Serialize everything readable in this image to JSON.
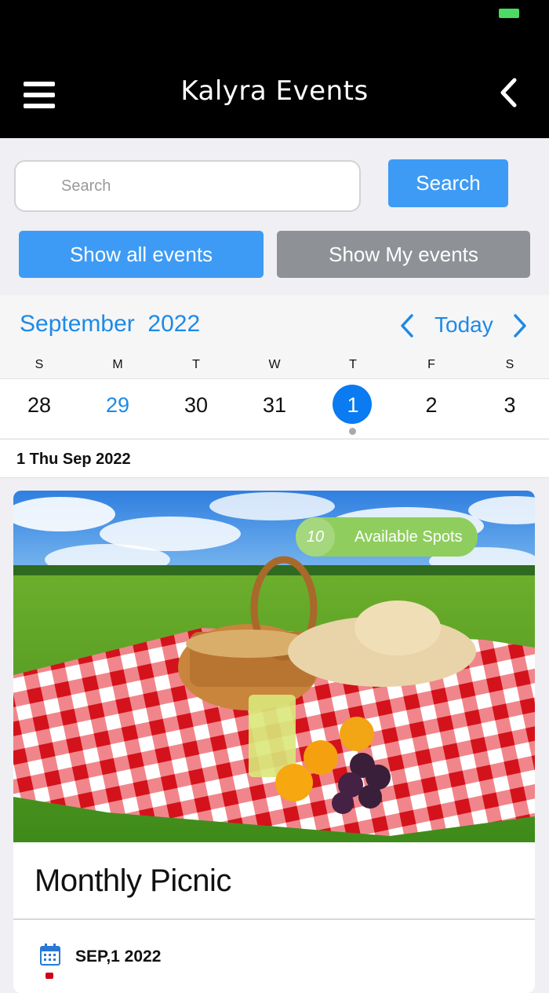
{
  "header": {
    "title": "Kalyra Events"
  },
  "search": {
    "placeholder": "Search",
    "value": "",
    "button_label": "Search"
  },
  "filters": {
    "all_label": "Show all events",
    "mine_label": "Show My events"
  },
  "calendar": {
    "month": "September",
    "year": "2022",
    "today_label": "Today",
    "weekdays": [
      "S",
      "M",
      "T",
      "W",
      "T",
      "F",
      "S"
    ],
    "days": [
      "28",
      "29",
      "30",
      "31",
      "1",
      "2",
      "3"
    ],
    "today_index": 1,
    "selected_index": 4
  },
  "selected_date_label": "1 Thu Sep 2022",
  "event": {
    "spots_count": "10",
    "spots_label": "Available Spots",
    "title": "Monthly Picnic",
    "date": "SEP,1 2022"
  },
  "colors": {
    "accent": "#3d9bf5",
    "calendar_blue": "#1d8ae7",
    "selected_day": "#0a7bf0",
    "secondary_button": "#8e9297",
    "spots_badge": "#8fce5e"
  },
  "icons": {
    "menu": "hamburger-icon",
    "back": "chevron-left-icon",
    "cal_prev": "chevron-left-icon",
    "cal_next": "chevron-right-icon",
    "event_date": "calendar-icon",
    "event_location": "map-pin-icon"
  }
}
